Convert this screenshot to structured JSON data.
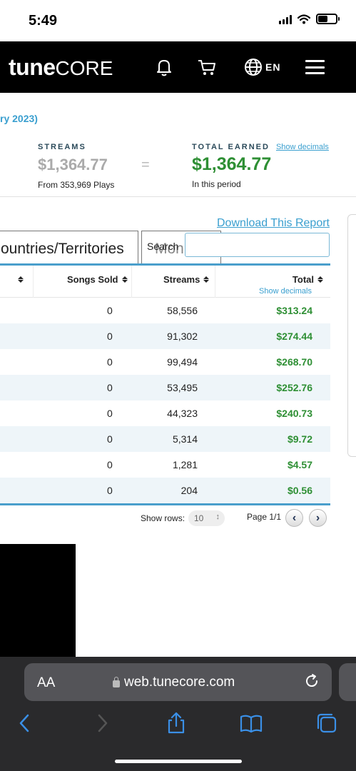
{
  "status_bar": {
    "time": "5:49"
  },
  "header": {
    "logo_bold": "tune",
    "logo_light": "CORE",
    "language": "EN",
    "icons": [
      "bell-icon",
      "cart-icon",
      "globe-icon",
      "hamburger-menu-icon"
    ]
  },
  "period_text": "ry 2023)",
  "summary": {
    "streams_label": "STREAMS",
    "streams_value": "$1,364.77",
    "streams_sub": "From 353,969 Plays",
    "equals": "=",
    "total_label": "TOTAL EARNED",
    "show_decimals": "Show decimals",
    "total_value": "$1,364.77",
    "total_sub": "In this period"
  },
  "download_label": "Download This Report",
  "tabs": {
    "countries": "ountries/Territories",
    "month": "Mon"
  },
  "search": {
    "label": "Search",
    "value": ""
  },
  "table": {
    "columns": {
      "songs_sold": "Songs Sold",
      "streams": "Streams",
      "total": "Total",
      "total_sub": "Show decimals"
    },
    "rows": [
      {
        "sold": "0",
        "streams": "58,556",
        "total": "$313.24"
      },
      {
        "sold": "0",
        "streams": "91,302",
        "total": "$274.44"
      },
      {
        "sold": "0",
        "streams": "99,494",
        "total": "$268.70"
      },
      {
        "sold": "0",
        "streams": "53,495",
        "total": "$252.76"
      },
      {
        "sold": "0",
        "streams": "44,323",
        "total": "$240.73"
      },
      {
        "sold": "0",
        "streams": "5,314",
        "total": "$9.72"
      },
      {
        "sold": "0",
        "streams": "1,281",
        "total": "$4.57"
      },
      {
        "sold": "0",
        "streams": "204",
        "total": "$0.56"
      }
    ]
  },
  "pager": {
    "show_rows_label": "Show rows:",
    "rows_value": "10",
    "page_label": "Page 1/1"
  },
  "safari": {
    "aa_label": "AA",
    "url": "web.tunecore.com"
  },
  "colors": {
    "accent_blue": "#3a9fcf",
    "earned_green": "#2e8f34",
    "header_black": "#000000"
  }
}
